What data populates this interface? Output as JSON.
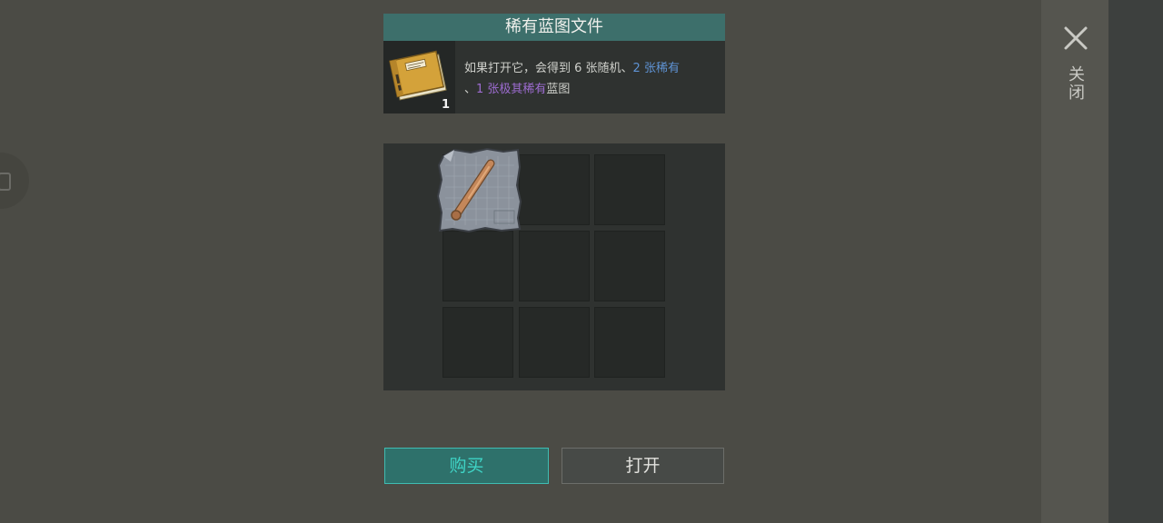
{
  "dialog": {
    "title": "稀有蓝图文件",
    "item_count": "1",
    "description": {
      "part1": "如果打开它，会得到 6 张随机、",
      "rare": "2 张稀有",
      "sep": "、",
      "epic": "1 张极其稀有",
      "part2": "蓝图"
    }
  },
  "grid": {
    "rows": 3,
    "cols": 3,
    "items": [
      {
        "slot": 0,
        "icon": "baseball-bat-blueprint-icon"
      }
    ]
  },
  "buttons": {
    "buy_label": "购买",
    "open_label": "打开"
  },
  "sidebar": {
    "close_label": "关闭",
    "close_icon": "close-icon"
  },
  "colors": {
    "header_teal": "#3d6f6b",
    "buy_accent": "#3fd4c6",
    "rare_blue": "#5f93d4",
    "epic_purple": "#9d6cd0"
  }
}
